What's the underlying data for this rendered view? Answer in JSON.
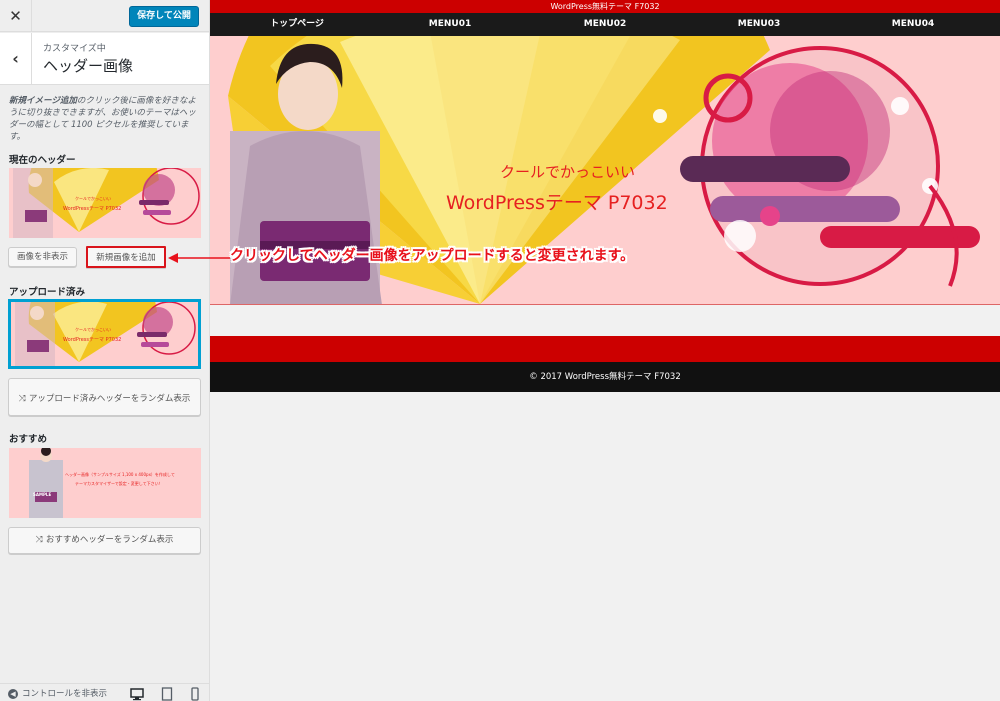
{
  "customizer": {
    "close_label": "✕",
    "publish_label": "保存して公開",
    "back_label": "‹",
    "customizing_label": "カスタマイズ中",
    "section_title": "ヘッダー画像",
    "description_bold": "新規イメージ追加",
    "description_rest": "のクリック後に画像を好きなように切り抜きできますが、お使いのテーマはヘッダーの幅として 1100 ピクセルを推奨しています。",
    "current_header_label": "現在のヘッダー",
    "hide_image_label": "画像を非表示",
    "add_image_label": "新規画像を追加",
    "uploaded_label": "アップロード済み",
    "random_uploaded_label": "アップロード済みヘッダーをランダム表示",
    "suggested_label": "おすすめ",
    "random_suggested_label": "おすすめヘッダーをランダム表示",
    "hide_controls_label": "コントロールを非表示"
  },
  "site": {
    "topbar_title": "WordPress無料テーマ F7032",
    "nav": [
      "トップページ",
      "MENU01",
      "MENU02",
      "MENU03",
      "MENU04"
    ],
    "hero_line1": "クールでかっこいい",
    "hero_line2": "WordPressテーマ P7032",
    "footer": "© 2017 WordPress無料テーマ F7032"
  },
  "suggested_thumb": {
    "line1": "ヘッダー画像（サンプルサイズ 1,100 x 400px）を作成して",
    "line2": "テーマカスタマイザーで設定・変更して下さい！",
    "stamp": "SAMPLE"
  },
  "annotation": {
    "text": "クリックしてヘッダー画像をアップロードすると変更されます。"
  },
  "colors": {
    "accent_blue": "#0085ba",
    "site_red": "#cc0000",
    "hero_pink": "#fecece",
    "annotation_red": "#e8111b"
  }
}
